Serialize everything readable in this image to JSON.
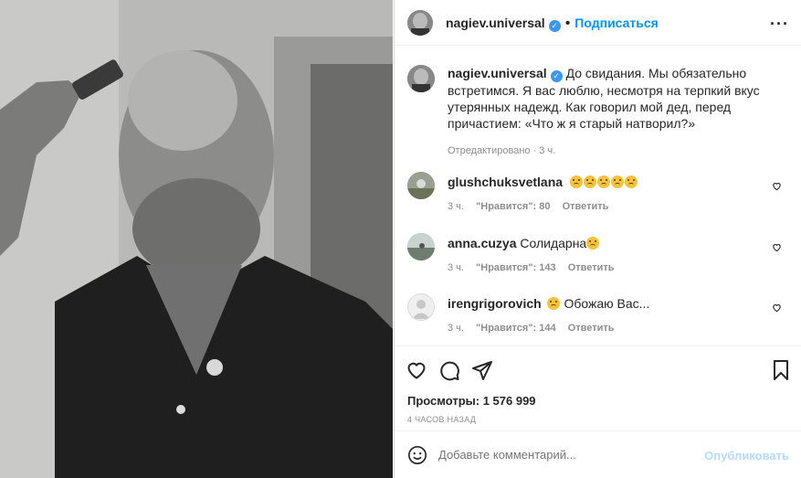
{
  "post": {
    "author": {
      "username": "nagiev.universal",
      "verified": true,
      "follow_label": "Подписаться"
    },
    "caption": "До свидания. Мы обязательно встретимся. Я вас люблю, несмотря на терпкий вкус утерянных надежд. Как говорил мой дед, перед причастием: «Что ж я старый натворил?»",
    "caption_meta": "Отредактировано · 3 ч.",
    "comments": [
      {
        "username": "glushchuksvetlana",
        "text": "",
        "emoji_count": 5,
        "time": "3 ч.",
        "likes": "\"Нравится\": 80",
        "reply": "Ответить"
      },
      {
        "username": "anna.cuzya",
        "text": "Солидарна",
        "emoji_count": 1,
        "time": "3 ч.",
        "likes": "\"Нравится\": 143",
        "reply": "Ответить"
      },
      {
        "username": "irengrigorovich",
        "text": "Обожаю Вас...",
        "emoji_count": 1,
        "time": "3 ч.",
        "likes": "\"Нравится\": 144",
        "reply": "Ответить"
      }
    ],
    "views": "Просмотры: 1 576 999",
    "posted": "4 ЧАСОВ НАЗАД",
    "add_comment_placeholder": "Добавьте комментарий...",
    "publish_label": "Опубликовать"
  },
  "colors": {
    "accent": "#0095f6",
    "verified": "#3897f0",
    "muted": "#8e8e8e",
    "publish_disabled": "#b3dbff"
  },
  "icons": [
    "heart-icon",
    "comment-icon",
    "share-icon",
    "bookmark-icon",
    "more-icon",
    "smile-icon",
    "verified-icon"
  ]
}
